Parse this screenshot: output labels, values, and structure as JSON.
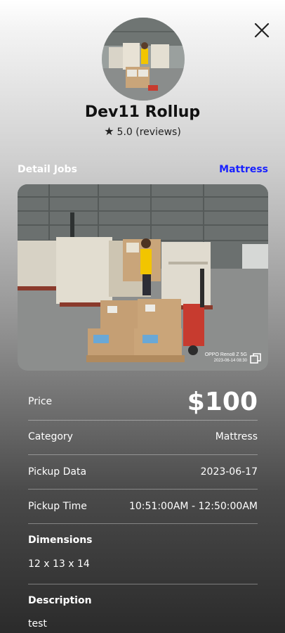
{
  "profile": {
    "name": "Dev11 Rollup",
    "rating_text": "5.0 (reviews)"
  },
  "section": {
    "detail_label": "Detail Jobs",
    "category_link": "Mattress"
  },
  "photo": {
    "watermark_device": "OPPO Reno8 Z 5G",
    "watermark_time": "2023-06-14 08:30"
  },
  "details": {
    "price_label": "Price",
    "price_value": "$100",
    "category_label": "Category",
    "category_value": "Mattress",
    "pickup_date_label": "Pickup Data",
    "pickup_date_value": "2023-06-17",
    "pickup_time_label": "Pickup Time",
    "pickup_time_value": "10:51:00AM - 12:50:00AM",
    "dimensions_label": "Dimensions",
    "dimensions_value": "12 x 13 x 14",
    "description_label": "Description",
    "description_value": "test"
  },
  "icons": {
    "close": "close-icon",
    "star": "star-icon",
    "expand": "expand-icon"
  },
  "colors": {
    "link": "#1a22ff",
    "worker_shirt": "#f2c500",
    "pallet_jack": "#c73b2f"
  }
}
